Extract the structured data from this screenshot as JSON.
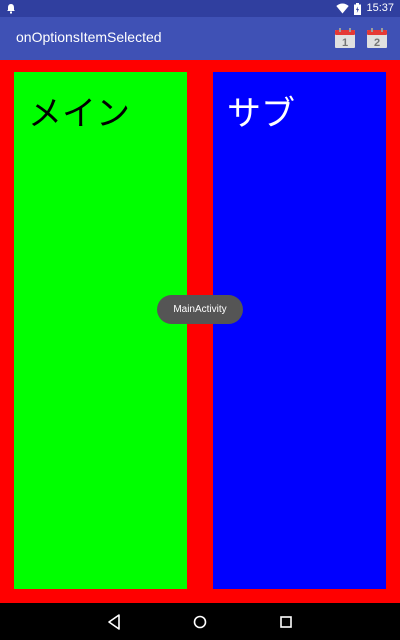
{
  "status_bar": {
    "time": "15:37",
    "icons": [
      "notification-icon",
      "wifi-icon",
      "battery-icon"
    ]
  },
  "app_bar": {
    "title": "onOptionsItemSelected",
    "actions": [
      {
        "icon": "calendar-icon",
        "label": "1"
      },
      {
        "icon": "calendar-icon",
        "label": "2"
      }
    ]
  },
  "panels": {
    "main_label": "メイン",
    "sub_label": "サブ"
  },
  "toast": {
    "text": "MainActivity"
  },
  "colors": {
    "status_bar": "#303f9f",
    "app_bar": "#3f51b5",
    "background": "#ff0000",
    "main_panel": "#00ff00",
    "sub_panel": "#0000ff"
  },
  "nav_bar": {
    "buttons": [
      "back-icon",
      "home-icon",
      "recents-icon"
    ]
  }
}
